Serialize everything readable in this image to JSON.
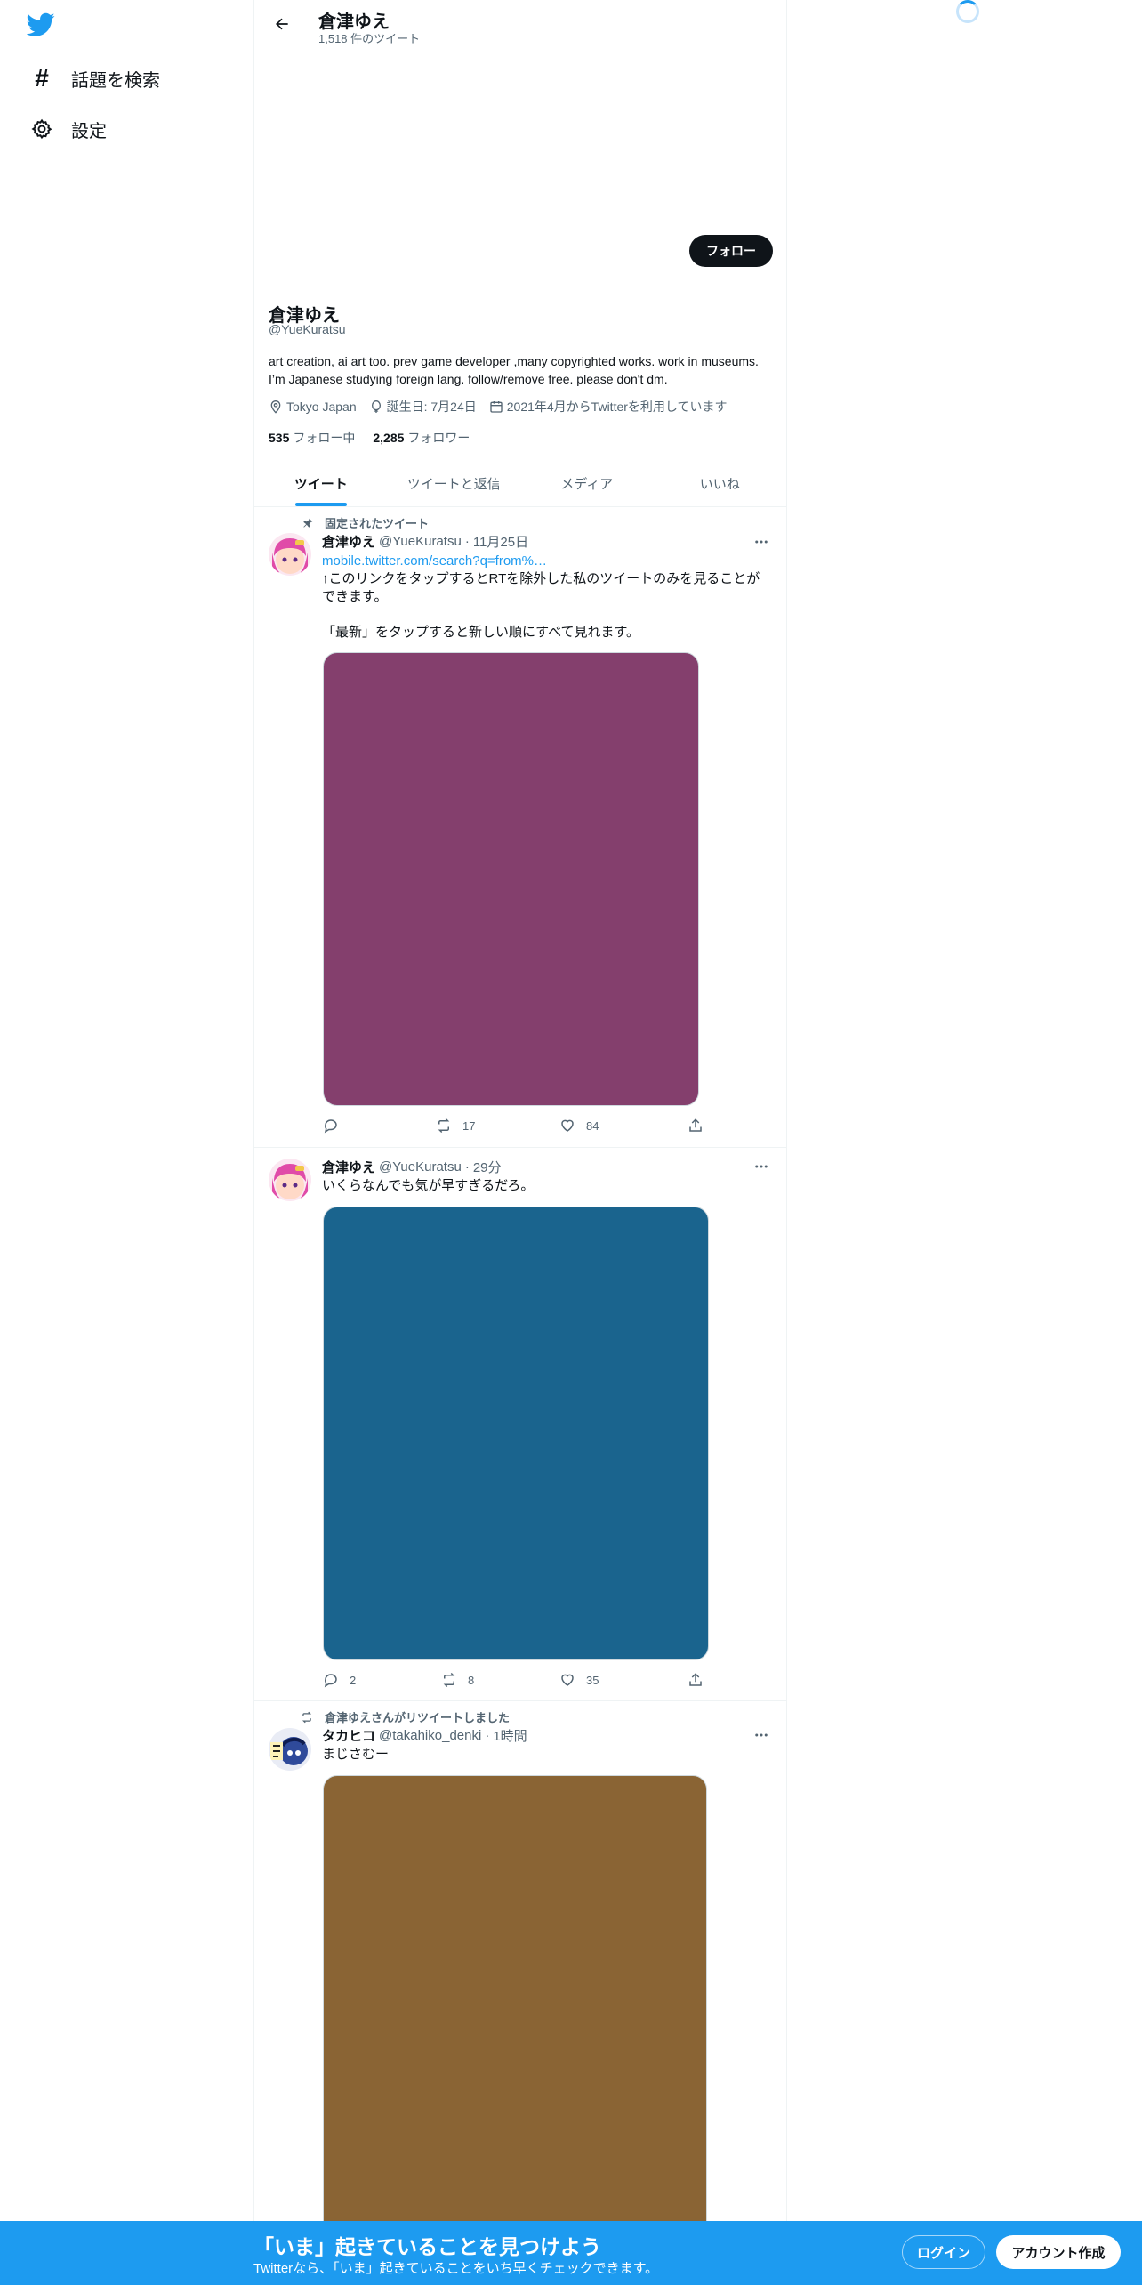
{
  "nav": {
    "items": [
      {
        "label": "話題を検索",
        "icon": "hashtag-icon"
      },
      {
        "label": "設定",
        "icon": "gear-icon"
      }
    ]
  },
  "header": {
    "title": "倉津ゆえ",
    "tweet_count": "1,518 件のツイート"
  },
  "profile": {
    "follow_label": "フォロー",
    "name": "倉津ゆえ",
    "handle": "@YueKuratsu",
    "bio": "art creation, ai art too. prev game developer ,many copyrighted works. work in museums. I’m Japanese studying foreign lang. follow/remove free. please don't dm.",
    "location": "Tokyo Japan",
    "birthday": "誕生日: 7月24日",
    "joined": "2021年4月からTwitterを利用しています",
    "following_count": "535",
    "following_label": "フォロー中",
    "followers_count": "2,285",
    "followers_label": "フォロワー"
  },
  "tabs": [
    {
      "label": "ツイート",
      "active": true
    },
    {
      "label": "ツイートと返信",
      "active": false
    },
    {
      "label": "メディア",
      "active": false
    },
    {
      "label": "いいね",
      "active": false
    }
  ],
  "tweets": [
    {
      "context": "固定されたツイート",
      "context_icon": "pin-icon",
      "name": "倉津ゆえ",
      "handle": "@YueKuratsu",
      "separator": "·",
      "date": "11月25日",
      "link": "mobile.twitter.com/search?q=from%…",
      "text_line1": "↑このリンクをタップするとRTを除外した私のツイートのみを見ることができます。",
      "text_line2": "「最新」をタップすると新しい順にすべて見れます。",
      "media_color": "#843f6d",
      "replies": "",
      "retweets": "17",
      "likes": "84"
    },
    {
      "context": "",
      "name": "倉津ゆえ",
      "handle": "@YueKuratsu",
      "separator": "·",
      "date": "29分",
      "text": "いくらなんでも気が早すぎるだろ。",
      "media_color": "#1a648e",
      "replies": "2",
      "retweets": "8",
      "likes": "35"
    },
    {
      "context": "倉津ゆえさんがリツイートしました",
      "context_icon": "retweet-icon",
      "name": "タカヒコ",
      "handle": "@takahiko_denki",
      "separator": "·",
      "date": "1時間",
      "text": "まじさむー",
      "media_color": "#8a6434"
    }
  ],
  "banner": {
    "title": "「いま」起きていることを見つけよう",
    "subtitle": "Twitterなら、「いま」起きていることをいち早くチェックできます。",
    "login_label": "ログイン",
    "signup_label": "アカウント作成"
  },
  "colors": {
    "accent": "#1d9bf0",
    "text": "#0f1419",
    "muted": "#536471"
  }
}
